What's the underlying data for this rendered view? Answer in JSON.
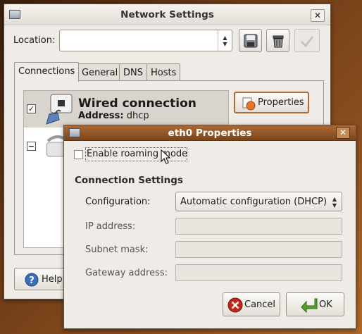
{
  "main_window": {
    "title": "Network Settings",
    "close_glyph": "✕",
    "location_label": "Location:",
    "location_value": "",
    "tabs": [
      "Connections",
      "General",
      "DNS",
      "Hosts"
    ],
    "connections": [
      {
        "name": "Wired connection",
        "address_label": "Address:",
        "address_value": "dhcp",
        "checked": "✓"
      },
      {
        "checked": "−"
      }
    ],
    "properties_label": "Properties",
    "help_label": "Help"
  },
  "dialog": {
    "title": "eth0 Properties",
    "close_glyph": "✕",
    "roaming_label": "Enable roaming mode",
    "section_title": "Connection Settings",
    "configuration_label": "Configuration:",
    "configuration_value": "Automatic configuration (DHCP)",
    "ip_label": "IP address:",
    "subnet_label": "Subnet mask:",
    "gateway_label": "Gateway address:",
    "cancel_label": "Cancel",
    "ok_label": "OK"
  },
  "colors": {
    "titlebar_active": "#9a5a2a",
    "window_bg": "#efebe7",
    "cancel_red": "#c0251a",
    "ok_green": "#5aa02c"
  }
}
